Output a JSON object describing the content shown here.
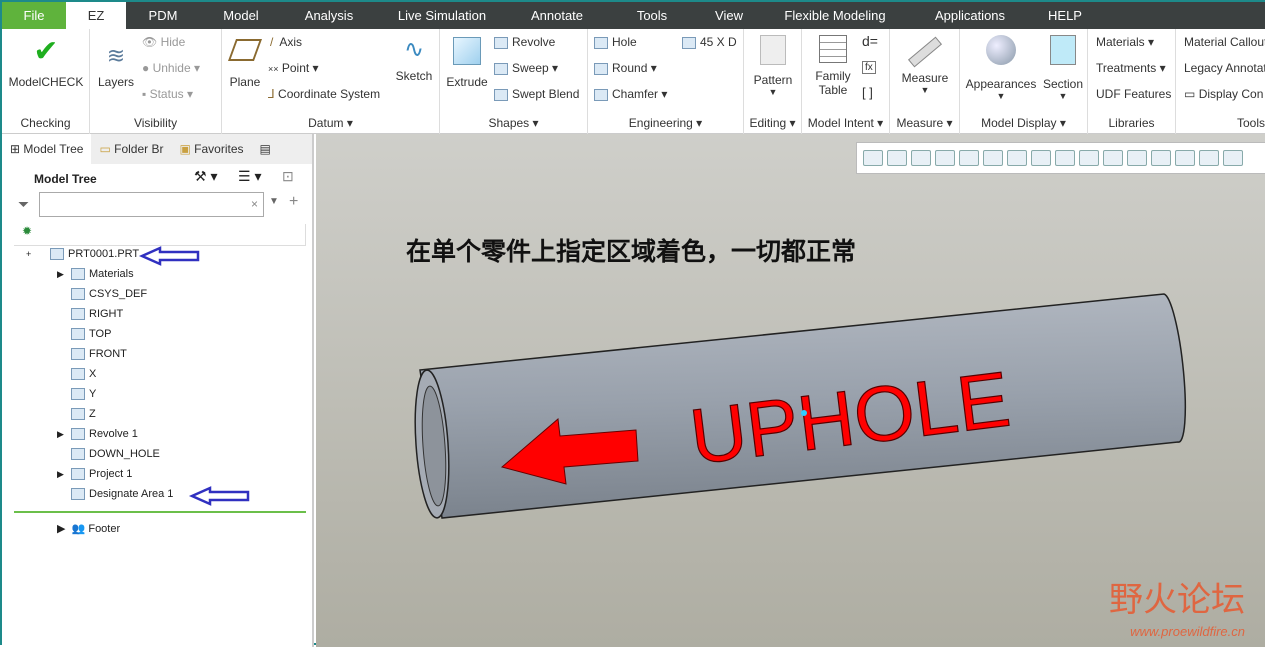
{
  "menu": {
    "tabs": [
      "File",
      "EZ",
      "PDM",
      "Model",
      "Analysis",
      "Live Simulation",
      "Annotate",
      "Tools",
      "View",
      "Flexible Modeling",
      "Applications",
      "HELP"
    ]
  },
  "ribbon": {
    "checking": {
      "modelcheck": "ModelCHECK",
      "label": "Checking"
    },
    "visibility": {
      "layers": "Layers",
      "hide": "Hide",
      "unhide": "Unhide",
      "status": "Status",
      "label": "Visibility"
    },
    "datum": {
      "plane": "Plane",
      "axis": "Axis",
      "point": "Point",
      "csys": "Coordinate System",
      "sketch": "Sketch",
      "label": "Datum"
    },
    "shapes": {
      "extrude": "Extrude",
      "revolve": "Revolve",
      "sweep": "Sweep",
      "swept_blend": "Swept Blend",
      "label": "Shapes"
    },
    "engineering": {
      "hole": "Hole",
      "round": "Round",
      "chamfer": "Chamfer",
      "c45": "45 X D",
      "label": "Engineering"
    },
    "editing": {
      "pattern": "Pattern",
      "label": "Editing"
    },
    "model_intent": {
      "family_table": "Family Table",
      "d_eq": "d=",
      "braces": "[ ]",
      "label": "Model Intent"
    },
    "measure": {
      "measure": "Measure",
      "label": "Measure"
    },
    "model_display": {
      "appearances": "Appearances",
      "section": "Section",
      "label": "Model Display"
    },
    "libraries": {
      "materials": "Materials",
      "treatments": "Treatments",
      "udf": "UDF Features",
      "label": "Libraries"
    },
    "tools": {
      "callout": "Material Callout",
      "legacy": "Legacy Annotat",
      "display": "Display Con",
      "label": "Tools"
    }
  },
  "panel": {
    "tabs": [
      "Model Tree",
      "Folder Br",
      "Favorites"
    ],
    "title": "Model Tree",
    "search_placeholder": "",
    "tree": [
      {
        "label": "PRT0001.PRT",
        "indent": 0,
        "exp": "+"
      },
      {
        "label": "Materials",
        "indent": 1,
        "exp": "▶"
      },
      {
        "label": "CSYS_DEF",
        "indent": 1,
        "exp": ""
      },
      {
        "label": "RIGHT",
        "indent": 1,
        "exp": ""
      },
      {
        "label": "TOP",
        "indent": 1,
        "exp": ""
      },
      {
        "label": "FRONT",
        "indent": 1,
        "exp": ""
      },
      {
        "label": "X",
        "indent": 1,
        "exp": ""
      },
      {
        "label": "Y",
        "indent": 1,
        "exp": ""
      },
      {
        "label": "Z",
        "indent": 1,
        "exp": ""
      },
      {
        "label": "Revolve 1",
        "indent": 1,
        "exp": "▶"
      },
      {
        "label": "DOWN_HOLE",
        "indent": 1,
        "exp": ""
      },
      {
        "label": "Project 1",
        "indent": 1,
        "exp": "▶"
      },
      {
        "label": "Designate Area 1",
        "indent": 1,
        "exp": ""
      }
    ],
    "footer": "Footer"
  },
  "view": {
    "annotation": "在单个零件上指定区域着色，一切都正常",
    "model_text": "UPHOLE",
    "watermark": "野火论坛",
    "watermark_url": "www.proewildfire.cn"
  },
  "colors": {
    "accent": "#5fb33c",
    "red": "#ff0000",
    "arrow_blue": "#3030c0"
  }
}
